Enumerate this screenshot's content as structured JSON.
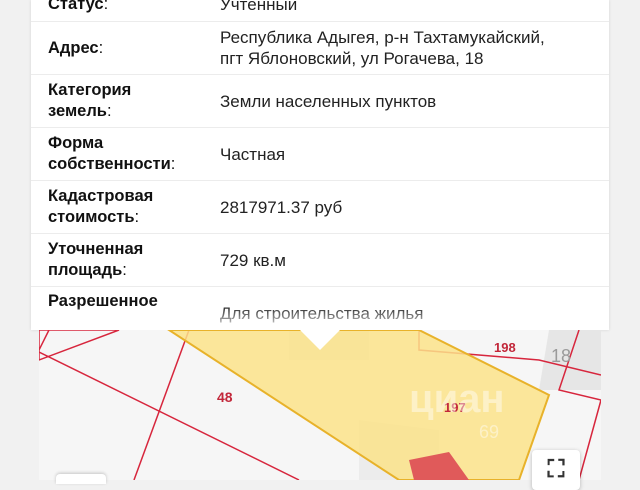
{
  "details": {
    "rows": [
      {
        "label": "Статус",
        "value": "Учтенный"
      },
      {
        "label": "Адрес",
        "value_lines": [
          "Республика Адыгея, р-н Тахтамукайский,",
          "пгт Яблоновский, ул Рогачева, 18"
        ]
      },
      {
        "label_lines": [
          "Категория",
          "земель"
        ],
        "value": "Земли населенных пунктов"
      },
      {
        "label_lines": [
          "Форма",
          "собственности"
        ],
        "value": "Частная"
      },
      {
        "label_lines": [
          "Кадастровая",
          "стоимость"
        ],
        "value": "2817971.37 руб"
      },
      {
        "label_lines": [
          "Уточненная",
          "площадь"
        ],
        "value": "729 кв.м"
      },
      {
        "label_lines": [
          "Разрешенное"
        ],
        "value": "Для строительства жилья"
      }
    ],
    "colon": ":"
  },
  "map": {
    "parcel_labels": {
      "p48": "48",
      "p197": "197",
      "p198": "198",
      "p18": "18"
    },
    "watermark": "циан",
    "watermark_phone": "69",
    "fullscreen_glyph": "⛶",
    "colors": {
      "boundary": "#d7263d",
      "selected_fill": "#fbe38a",
      "selected_stroke": "#e8b22a",
      "building": "#e05a5a"
    }
  }
}
